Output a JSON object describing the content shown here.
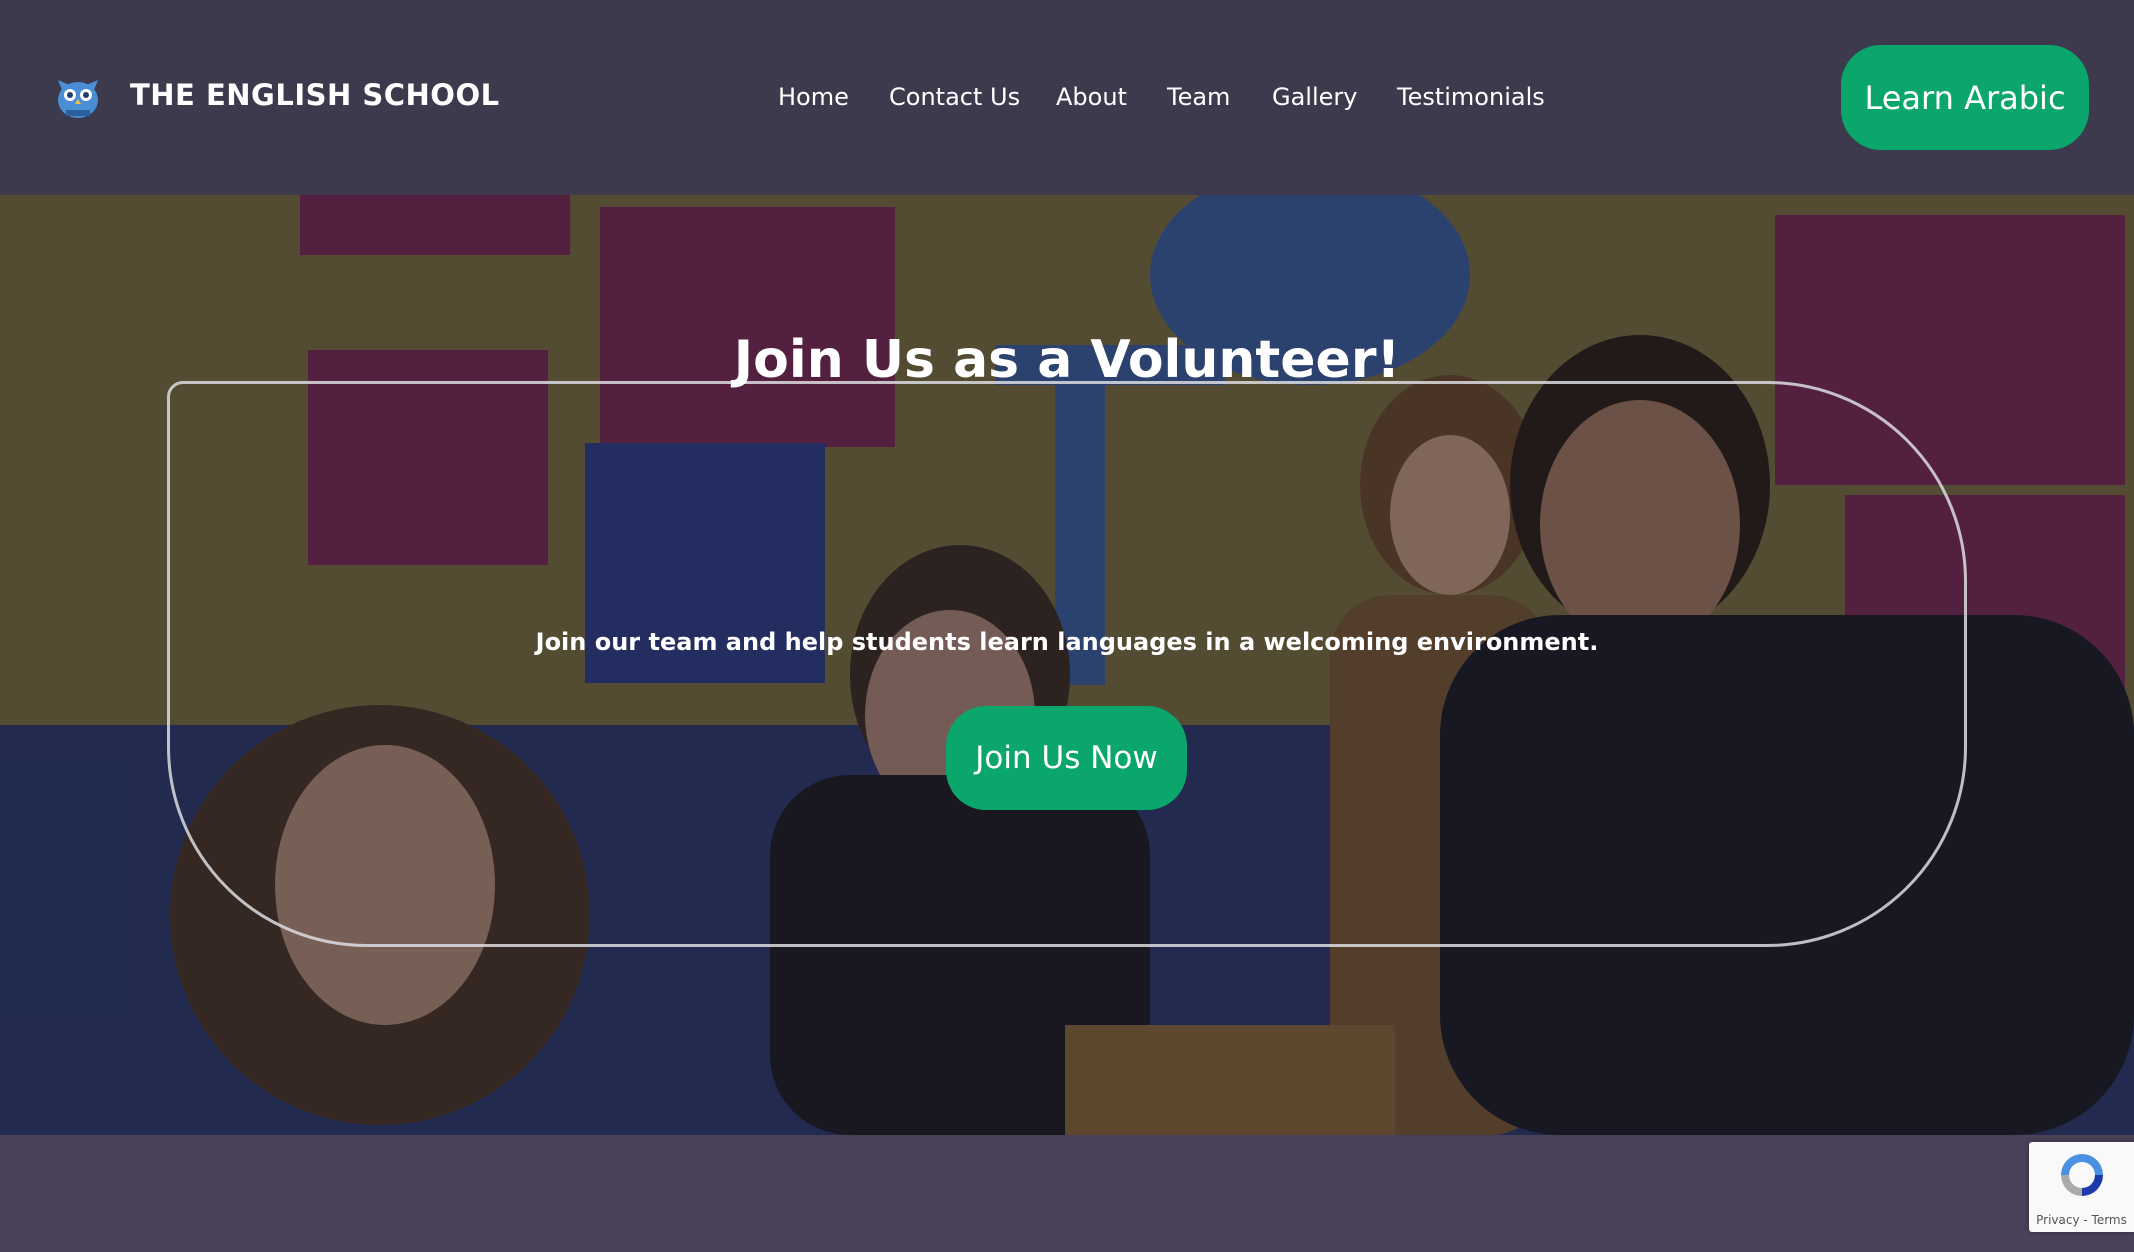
{
  "header": {
    "brand": "THE ENGLISH SCHOOL",
    "logo_icon": "owl-logo-icon",
    "nav": [
      {
        "label": "Home"
      },
      {
        "label": "Contact Us"
      },
      {
        "label": "About"
      },
      {
        "label": "Team"
      },
      {
        "label": "Gallery"
      },
      {
        "label": "Testimonials"
      }
    ],
    "cta_label": "Learn Arabic"
  },
  "hero": {
    "title": "Join Us as a Volunteer!",
    "subtitle": "Join our team and help students learn languages in a welcoming environment.",
    "button_label": "Join Us Now",
    "background": "photo of smiling volunteers in a classroom"
  },
  "recaptcha": {
    "icon": "recaptcha-icon",
    "privacy": "Privacy",
    "separator": " - ",
    "terms": "Terms"
  },
  "colors": {
    "header_bg": "#3d3a4e",
    "accent": "#0aa66b",
    "band_bg": "#4a4058",
    "text": "#ffffff"
  }
}
